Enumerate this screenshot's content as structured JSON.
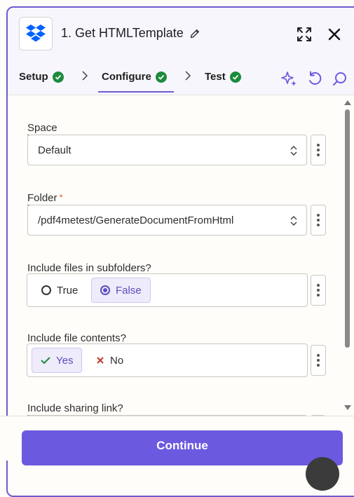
{
  "header": {
    "step_title": "1. Get HTMLTemplate"
  },
  "tabs": [
    {
      "label": "Setup",
      "status": "complete"
    },
    {
      "label": "Configure",
      "status": "complete",
      "active": true
    },
    {
      "label": "Test",
      "status": "complete"
    }
  ],
  "fields": {
    "space": {
      "label": "Space",
      "value": "Default"
    },
    "folder": {
      "label": "Folder",
      "required_mark": "*",
      "value": "/pdf4metest/GenerateDocumentFromHtml"
    },
    "include_subfolders": {
      "label": "Include files in subfolders?",
      "options": [
        "True",
        "False"
      ],
      "selected": "False"
    },
    "include_contents": {
      "label": "Include file contents?",
      "options": [
        "Yes",
        "No"
      ],
      "selected": "Yes"
    },
    "sharing_link": {
      "label": "Include sharing link?"
    }
  },
  "footer": {
    "continue_label": "Continue"
  },
  "colors": {
    "accent": "#6b5ae0",
    "success": "#1d8b3c",
    "required": "#e45a2c",
    "dropbox": "#0061fe"
  },
  "icons": [
    "dropbox-logo",
    "pencil-icon",
    "expand-icon",
    "close-icon",
    "check-icon",
    "chevron-right-icon",
    "sparkle-icon",
    "undo-icon",
    "search-icon",
    "up-down-icon",
    "more-vertical-icon",
    "x-icon"
  ]
}
